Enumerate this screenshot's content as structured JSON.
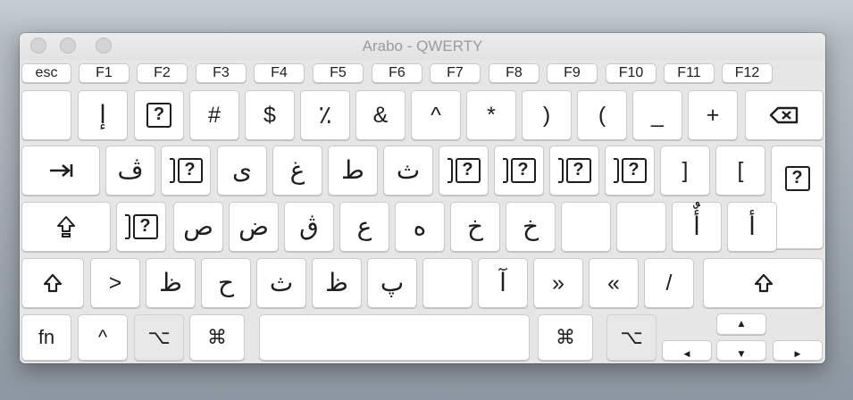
{
  "window": {
    "title": "Arabo - QWERTY"
  },
  "fn_row": [
    "esc",
    "F1",
    "F2",
    "F3",
    "F4",
    "F5",
    "F6",
    "F7",
    "F8",
    "F9",
    "F10",
    "F11",
    "F12"
  ],
  "row1": [
    "",
    "إ",
    "?",
    "#",
    "$",
    "٪",
    "&",
    "^",
    "*",
    ")",
    "(",
    "_",
    "+"
  ],
  "row2": [
    "ڤ",
    "?",
    "ى",
    "غ",
    "ط",
    "ث",
    "?",
    "?",
    "?",
    "?",
    "]",
    "[",
    "?"
  ],
  "row3": [
    "?",
    "ص",
    "ض",
    "ڨ",
    "ع",
    "ه",
    "خ",
    "خ",
    "",
    "",
    "أٌ",
    "أ"
  ],
  "row4": [
    ">",
    "ظ",
    "ح",
    "ث",
    "ظ",
    "پ",
    "",
    "آ",
    "»",
    "«",
    "/"
  ],
  "bottom": {
    "fn": "fn",
    "control": "^",
    "option": "⌥",
    "command": "⌘"
  },
  "icons": {
    "delete": "delete-icon",
    "tab": "tab-icon",
    "capslock": "capslock-icon",
    "shift": "shift-icon",
    "arrows": [
      "up-arrow-icon",
      "down-arrow-icon",
      "left-arrow-icon",
      "right-arrow-icon"
    ]
  },
  "colors": {
    "key": "#ffffff",
    "pressed_key": "#e8e8e8",
    "window": "#e6e6e6",
    "title": "#9b9b9b"
  }
}
